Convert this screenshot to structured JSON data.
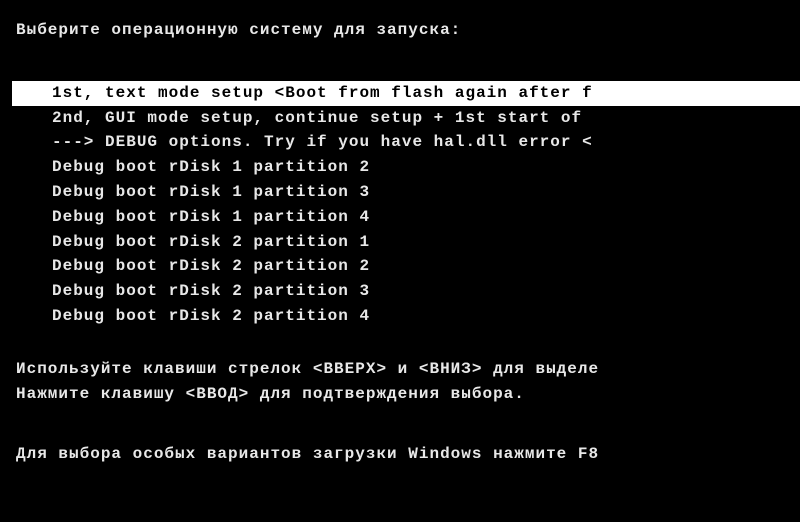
{
  "title": "Выберите операционную систему для запуска:",
  "menu": {
    "items": [
      {
        "label": "1st, text mode setup <Boot from flash again after f",
        "selected": true
      },
      {
        "label": "2nd, GUI mode setup, continue setup + 1st start of ",
        "selected": false
      },
      {
        "label": "---> DEBUG options. Try if you have hal.dll error <",
        "selected": false
      },
      {
        "label": "Debug boot rDisk 1 partition 2",
        "selected": false
      },
      {
        "label": "Debug boot rDisk 1 partition 3",
        "selected": false
      },
      {
        "label": "Debug boot rDisk 1 partition 4",
        "selected": false
      },
      {
        "label": "Debug boot rDisk 2 partition 1",
        "selected": false
      },
      {
        "label": "Debug boot rDisk 2 partition 2",
        "selected": false
      },
      {
        "label": "Debug boot rDisk 2 partition 3",
        "selected": false
      },
      {
        "label": "Debug boot rDisk 2 partition 4",
        "selected": false
      }
    ]
  },
  "instructions": {
    "line1": "Используйте клавиши стрелок <ВВЕРХ> и <ВНИЗ> для выделе",
    "line2": "Нажмите клавишу <ВВОД> для подтверждения выбора."
  },
  "footer": "Для выбора особых вариантов загрузки Windows нажмите F8"
}
